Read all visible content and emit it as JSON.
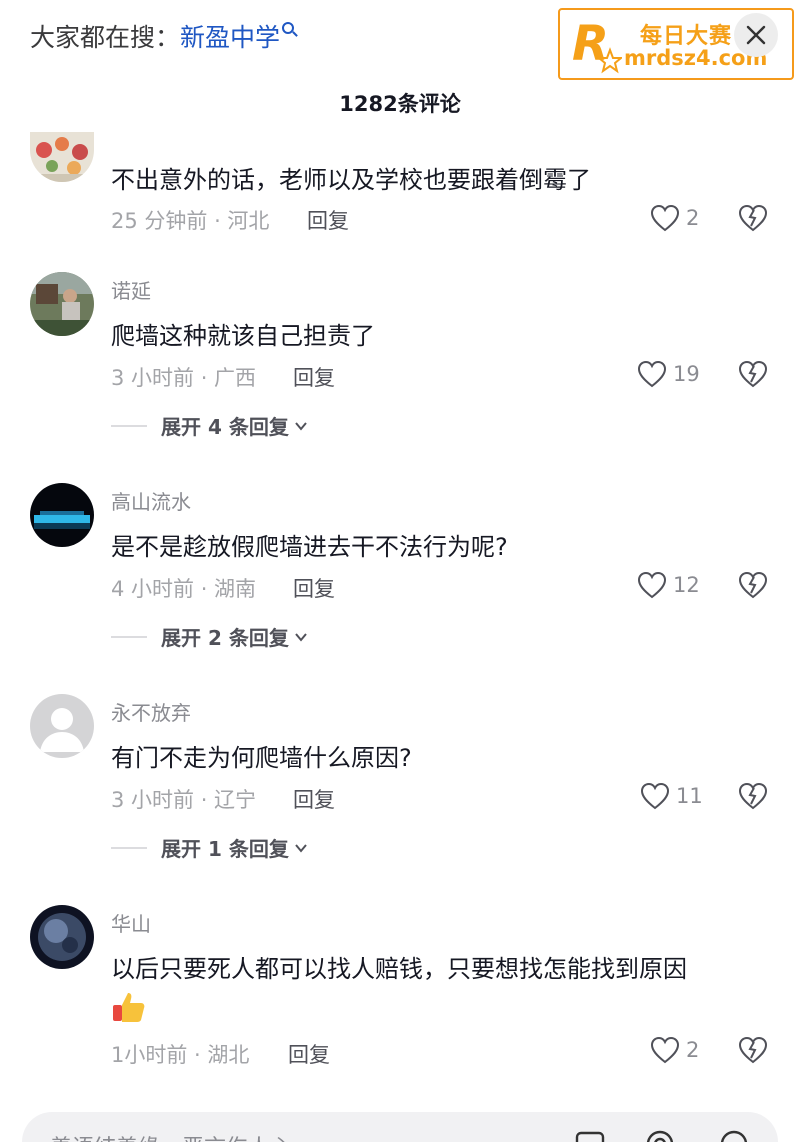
{
  "top": {
    "search_prefix": "大家都在搜：",
    "search_keyword": "新盈中学"
  },
  "watermark": {
    "title": "每日大赛",
    "url": "mrdsz4.com",
    "logo_sub": "每日大赛"
  },
  "header": {
    "title": "1282条评论"
  },
  "comments": [
    {
      "username": "",
      "content": "不出意外的话，老师以及学校也要跟着倒霉了",
      "meta": "25 分钟前 · 河北",
      "reply_label": "回复",
      "likes": "2"
    },
    {
      "username": "诺延",
      "content": "爬墙这种就该自己担责了",
      "meta": "3 小时前 · 广西",
      "reply_label": "回复",
      "likes": "19",
      "expand_label": "展开 4 条回复"
    },
    {
      "username": "高山流水",
      "content": "是不是趁放假爬墙进去干不法行为呢?",
      "meta": "4 小时前 · 湖南",
      "reply_label": "回复",
      "likes": "12",
      "expand_label": "展开 2 条回复"
    },
    {
      "username": "永不放弃",
      "content": "有门不走为何爬墙什么原因?",
      "meta": "3 小时前 · 辽宁",
      "reply_label": "回复",
      "likes": "11",
      "expand_label": "展开 1 条回复"
    },
    {
      "username": "华山",
      "content": "以后只要死人都可以找人赔钱，只要想找怎能找到原因",
      "meta": "1小时前 · 湖北",
      "reply_label": "回复",
      "likes": "2"
    }
  ],
  "input": {
    "placeholder": "善语结善缘，恶言伤人心"
  },
  "colors": {
    "accent": "#1f57c3",
    "watermark": "#f5a018",
    "muted": "#a3a4a8"
  }
}
